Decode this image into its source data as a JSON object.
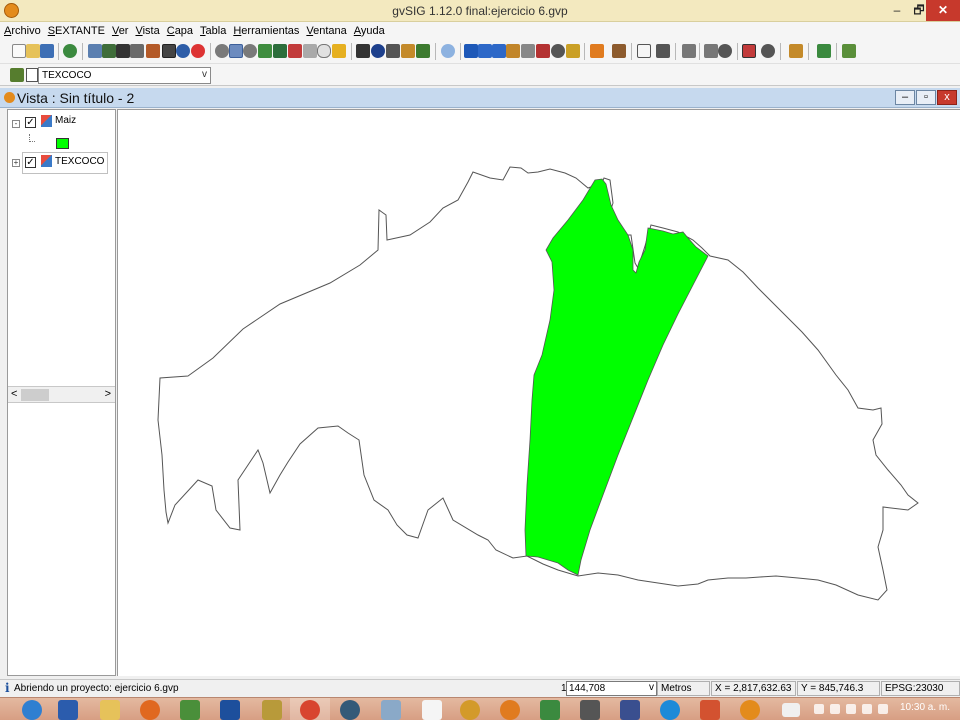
{
  "window": {
    "title": "gvSIG 1.12.0 final:ejercicio 6.gvp",
    "min_glyph": "–",
    "max_glyph": "🗗",
    "close_glyph": "✕"
  },
  "menu": [
    "Archivo",
    "SEXTANTE",
    "Ver",
    "Vista",
    "Capa",
    "Tabla",
    "Herramientas",
    "Ventana",
    "Ayuda"
  ],
  "layer_selector": {
    "value": "TEXCOCO",
    "arrow": "v"
  },
  "view": {
    "title": "Vista : Sin título - 2",
    "min_glyph": "–",
    "max_glyph": "▫",
    "close_glyph": "x"
  },
  "toc": {
    "layers": [
      {
        "name": "Maiz",
        "checked": "✓",
        "expander": "-",
        "symbol_color": "#00ff00"
      },
      {
        "name": "TEXCOCO",
        "checked": "✓",
        "expander": "+"
      }
    ],
    "scroll_left": "<",
    "scroll_right": ">"
  },
  "map": {
    "outline_color": "#555555",
    "fill_color": "#00ff00"
  },
  "status": {
    "icon": "i",
    "message": "Abriendo un proyecto: ejercicio 6.gvp",
    "scale_prefix": "1:",
    "scale": "144,708",
    "scale_arrow": "v",
    "units": "Metros",
    "x": "X = 2,817,632.63",
    "y": "Y = 845,746.3",
    "epsg": "EPSG:23030"
  },
  "taskbar": {
    "clock": "10:30 a. m."
  }
}
